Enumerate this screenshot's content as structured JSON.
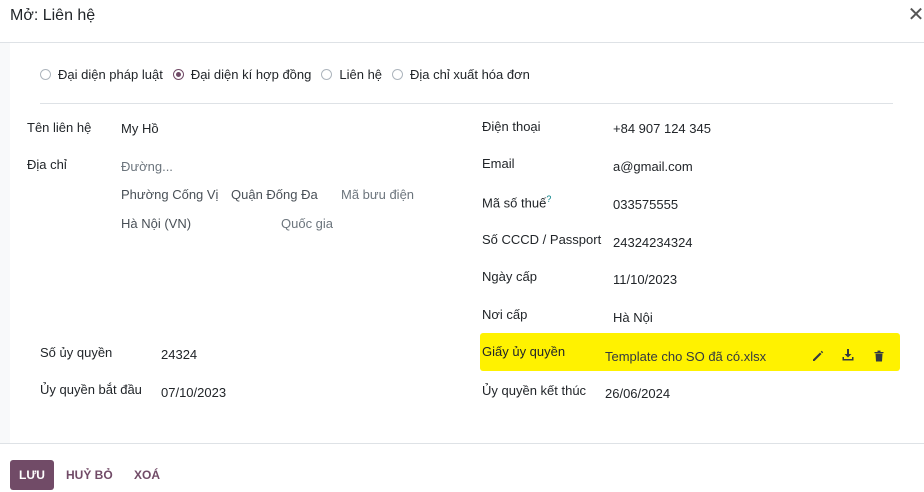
{
  "dialog": {
    "title": "Mở: Liên hệ"
  },
  "radios": [
    {
      "label": "Đại diện pháp luật",
      "checked": false
    },
    {
      "label": "Đại diện kí hợp đồng",
      "checked": true
    },
    {
      "label": "Liên hệ",
      "checked": false
    },
    {
      "label": "Địa chỉ xuất hóa đơn",
      "checked": false
    }
  ],
  "left": {
    "contact_name_label": "Tên liên hệ",
    "contact_name_value": "My Hồ",
    "address_label": "Địa chỉ",
    "street_placeholder": "Đường...",
    "ward_value": "Phường Cống Vị",
    "district_value": "Quận Đống Đa",
    "zip_placeholder": "Mã bưu điện",
    "city_value": "Hà Nội (VN)",
    "country_placeholder": "Quốc gia",
    "auth_no_label": "Số ủy quyền",
    "auth_no_value": "24324",
    "auth_start_label": "Ủy quyền bắt đầu",
    "auth_start_value": "07/10/2023"
  },
  "right": {
    "phone_label": "Điện thoại",
    "phone_value": "+84 907 124 345",
    "email_label": "Email",
    "email_value": "a@gmail.com",
    "tax_label": "Mã số thuế",
    "tax_help": "?",
    "tax_value": "033575555",
    "id_label": "Số CCCD / Passport",
    "id_value": "24324234324",
    "issue_date_label": "Ngày cấp",
    "issue_date_value": "11/10/2023",
    "issue_place_label": "Nơi cấp",
    "issue_place_value": "Hà Nội",
    "auth_doc_label": "Giấy ủy quyền",
    "auth_doc_value": "Template cho SO đã có.xlsx",
    "auth_end_label": "Ủy quyền kết thúc",
    "auth_end_value": "26/06/2024"
  },
  "footer": {
    "save": "LƯU",
    "discard": "HUỶ BỎ",
    "delete": "XOÁ"
  },
  "colors": {
    "primary": "#714b67",
    "highlight": "#fff200"
  },
  "icons": {
    "close": "close-icon",
    "edit": "pencil-icon",
    "download": "download-icon",
    "delete": "trash-icon"
  }
}
